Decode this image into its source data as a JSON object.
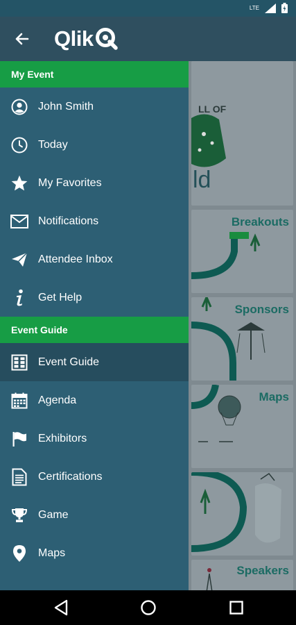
{
  "status_bar": {
    "network": "LTE",
    "icons": [
      "signal-icon",
      "battery-icon"
    ]
  },
  "header": {
    "back_icon": "arrow-left-icon",
    "logo_text": "Qlik"
  },
  "drawer": {
    "sections": [
      {
        "title": "My Event",
        "items": [
          {
            "label": "John Smith",
            "icon": "user-circle-icon"
          },
          {
            "label": "Today",
            "icon": "clock-icon"
          },
          {
            "label": "My Favorites",
            "icon": "star-icon"
          },
          {
            "label": "Notifications",
            "icon": "envelope-icon"
          },
          {
            "label": "Attendee Inbox",
            "icon": "paper-plane-icon"
          },
          {
            "label": "Get Help",
            "icon": "info-icon"
          }
        ]
      },
      {
        "title": "Event Guide",
        "items": [
          {
            "label": "Event Guide",
            "icon": "grid-icon",
            "active": true
          },
          {
            "label": "Agenda",
            "icon": "calendar-icon"
          },
          {
            "label": "Exhibitors",
            "icon": "flag-icon"
          },
          {
            "label": "Certifications",
            "icon": "document-icon"
          },
          {
            "label": "Game",
            "icon": "trophy-icon"
          },
          {
            "label": "Maps",
            "icon": "map-pin-icon"
          }
        ]
      }
    ]
  },
  "background_tiles": {
    "breakouts": "Breakouts",
    "sponsors": "Sponsors",
    "maps": "Maps",
    "speakers": "Speakers",
    "world_fragment": "ld"
  },
  "colors": {
    "drawer_bg": "#2d5f74",
    "section_green": "#179d45",
    "active_item": "#264d5e",
    "appbar": "#2f4f5f"
  },
  "nav_bar": {
    "buttons": [
      "back-triangle-icon",
      "home-circle-icon",
      "recents-square-icon"
    ]
  }
}
